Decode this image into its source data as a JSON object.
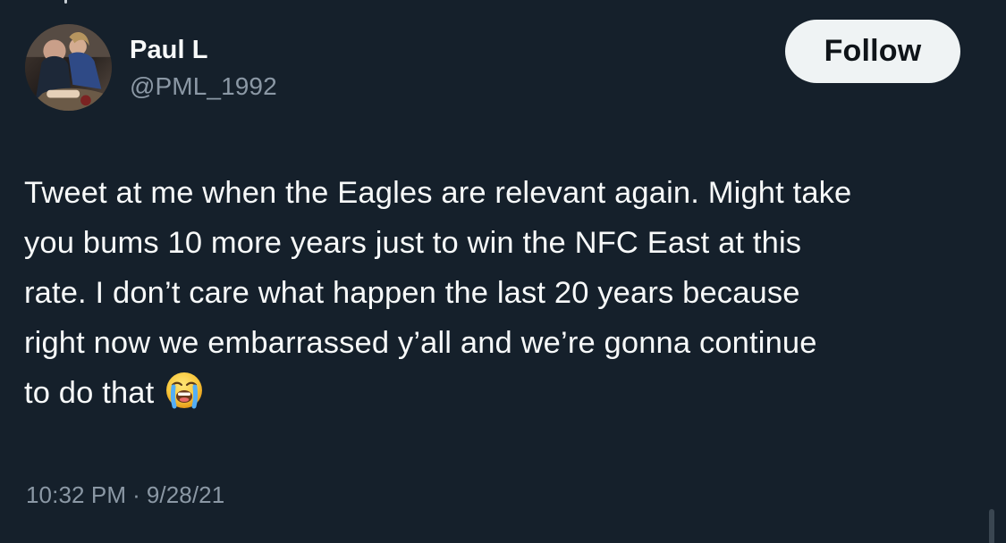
{
  "author": {
    "display_name": "Paul L",
    "handle": "@PML_1992"
  },
  "follow_label": "Follow",
  "tweet": {
    "lines": [
      "Tweet at me when the Eagles are relevant again. Might take",
      "you bums 10 more years just to win the NFC East at this",
      "rate. I don’t care what happen the last 20 years because",
      "right now we embarrassed y’all and we’re gonna continue",
      "to do that"
    ],
    "emoji": "loudly-crying-face-emoji"
  },
  "meta": {
    "time": "10:32 PM",
    "separator": "·",
    "date": "9/28/21"
  },
  "colors": {
    "background": "#15202b",
    "text": "#f7f9f9",
    "secondary_text": "#8b98a5",
    "follow_button_bg": "#eff3f4",
    "follow_button_text": "#0f1419"
  },
  "icons": {
    "avatar": "profile-photo",
    "emoji": "loudly-crying-face-emoji"
  }
}
